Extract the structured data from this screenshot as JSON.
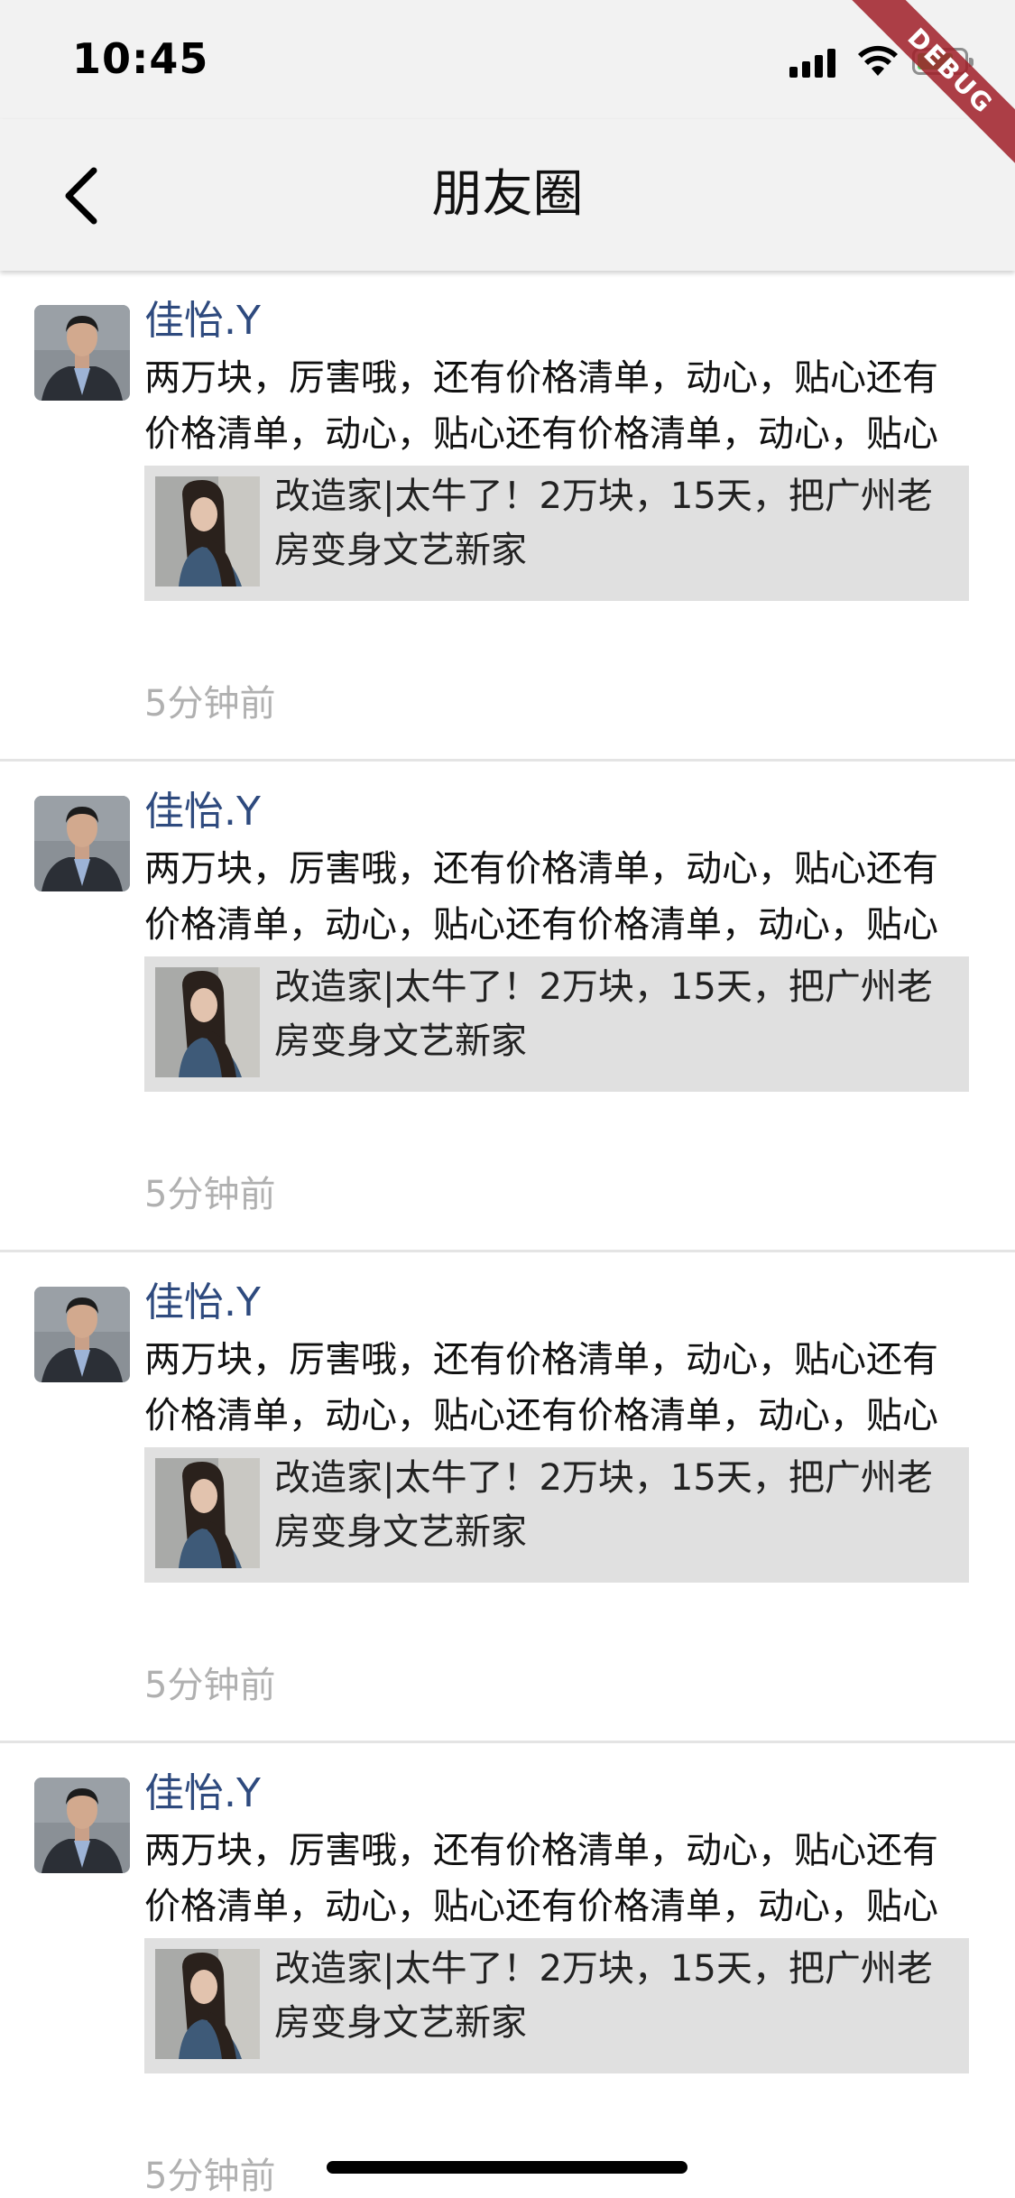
{
  "status_bar": {
    "time": "10:45",
    "debug_label": "DEBUG",
    "battery_color": "#4cd964"
  },
  "nav": {
    "title": "朋友圈",
    "back_icon": "chevron-left-icon"
  },
  "colors": {
    "author_name": "#2e4a7e",
    "share_card_bg": "#e0e0e0",
    "timestamp": "#b0b0b0"
  },
  "posts": [
    {
      "author": "佳怡.Y",
      "text": "两万块，厉害哦，还有价格清单，动心，贴心还有价格清单，动心，贴心还有价格清单，动心，贴心",
      "share_title": "改造家|太牛了！2万块，15天，把广州老房变身文艺新家",
      "time": "5分钟前"
    },
    {
      "author": "佳怡.Y",
      "text": "两万块，厉害哦，还有价格清单，动心，贴心还有价格清单，动心，贴心还有价格清单，动心，贴心",
      "share_title": "改造家|太牛了！2万块，15天，把广州老房变身文艺新家",
      "time": "5分钟前"
    },
    {
      "author": "佳怡.Y",
      "text": "两万块，厉害哦，还有价格清单，动心，贴心还有价格清单，动心，贴心还有价格清单，动心，贴心",
      "share_title": "改造家|太牛了！2万块，15天，把广州老房变身文艺新家",
      "time": "5分钟前"
    },
    {
      "author": "佳怡.Y",
      "text": "两万块，厉害哦，还有价格清单，动心，贴心还有价格清单，动心，贴心还有价格清单，动心，贴心",
      "share_title": "改造家|太牛了！2万块，15天，把广州老房变身文艺新家",
      "time": "5分钟前"
    }
  ]
}
